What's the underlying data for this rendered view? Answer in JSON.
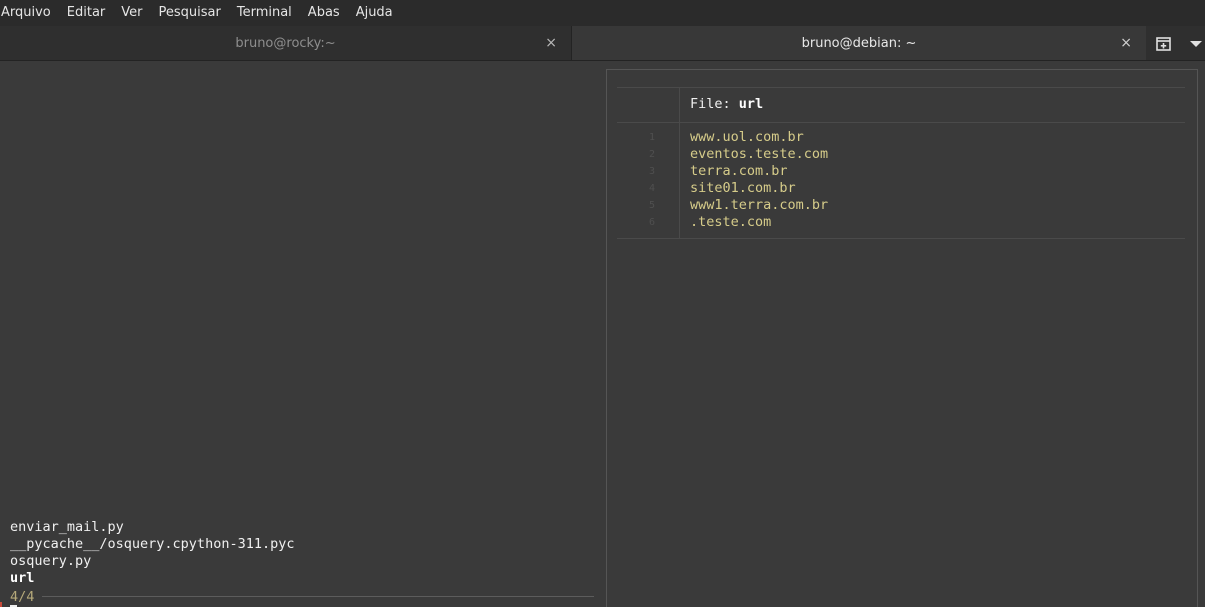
{
  "menu": [
    "Arquivo",
    "Editar",
    "Ver",
    "Pesquisar",
    "Terminal",
    "Abas",
    "Ajuda"
  ],
  "tabs": [
    {
      "title": "bruno@rocky:~",
      "active": false
    },
    {
      "title": "bruno@debian: ~",
      "active": true
    }
  ],
  "icons": {
    "close": "×",
    "new_tab": "new-tab-icon",
    "menu": "chevron-down-icon"
  },
  "left_terminal": {
    "files": [
      "enviar_mail.py",
      "__pycache__/osquery.cpython-311.pyc",
      "osquery.py",
      "url"
    ],
    "selected_index": 3,
    "counter": "4/4"
  },
  "right_terminal": {
    "file_prefix": "File: ",
    "file_name": "url",
    "lines": [
      {
        "num": "1",
        "text": "www.uol.com.br"
      },
      {
        "num": "2",
        "text": "eventos.teste.com"
      },
      {
        "num": "3",
        "text": "terra.com.br"
      },
      {
        "num": "4",
        "text": "site01.com.br"
      },
      {
        "num": "5",
        "text": "www1.terra.com.br"
      },
      {
        "num": "6",
        "text": ".teste.com"
      }
    ]
  },
  "colors": {
    "accent_text": "#d6cc8a",
    "counter": "#b5a97a",
    "background": "#3a3a3a"
  }
}
